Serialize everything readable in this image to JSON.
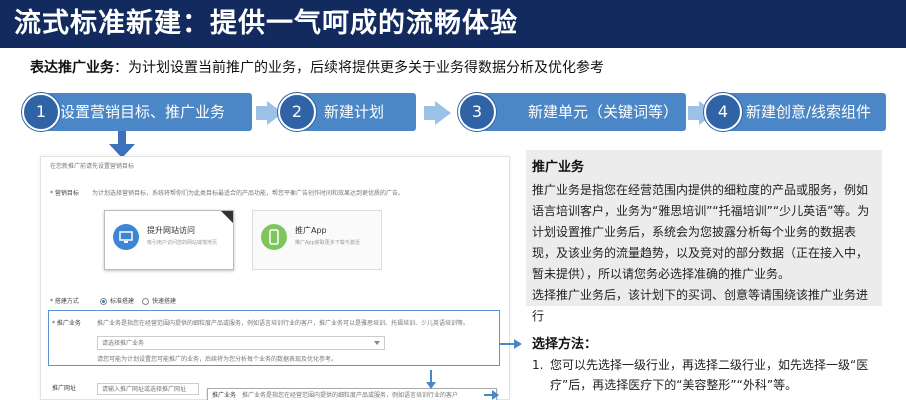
{
  "banner": {
    "title": "流式标准新建：提供一气呵成的流畅体验"
  },
  "intro": {
    "term": "表达推广业务",
    "text": "：为计划设置当前推广的业务，后续将提供更多关于业务得数据分析及优化参考"
  },
  "steps": [
    {
      "num": "1",
      "label": "设置营销目标、推广业务"
    },
    {
      "num": "2",
      "label": "新建计划"
    },
    {
      "num": "3",
      "label": "新建单元（关键词等）"
    },
    {
      "num": "4",
      "label": "新建创意/线索组件"
    }
  ],
  "form": {
    "header": "在您新推广前请先设置营销目标",
    "goal_label": "* 营销目标",
    "goal_hint": "为计划选择营销目标，系统将帮你们为此类目标最适合的产品功能，帮您平衡广告创作时间和效果达到更优质的广告。",
    "goals": [
      {
        "title": "提升网站访问",
        "sub": "吸引用户访问您的网站或落地页"
      },
      {
        "title": "推广App",
        "sub": "推广App获取更多下载与激活"
      }
    ],
    "mode_label": "* 搭建方式",
    "mode_options": [
      "标准搭建",
      "快速搭建"
    ],
    "business_label": "* 推广业务",
    "business_hint": "推广业务是指您在经营范围内提供的细粒度产品或服务，例如语言培训行业的客户，推广业务可以是雅思培训、托福培训、少儿英语培训等。",
    "business_placeholder": "请选择推广业务",
    "business_note": "请您可能为计划设置您可能推广的业务，后续将为您分析每个业务的数据表现及优化参考。",
    "url_label": "推广网址",
    "url_placeholder": "请输入推广网址或选择推广网址",
    "callout_label": "推广业务",
    "callout_text": "推广业务是指您在经营范围内提供的细粒度产品或服务，例如语言培训行业的客户"
  },
  "explain": {
    "title": "推广业务",
    "body": "推广业务是指您在经营范围内提供的细粒度的产品或服务，例如语言培训客户，业务为“雅思培训”“托福培训”“少儿英语”等。为计划设置推广业务后，系统会为您披露分析每个业务的数据表现，及该业务的流量趋势，以及竞对的部分数据（正在接入中，暂未提供），所以请您务必选择准确的推广业务。",
    "note": "选择推广业务后，该计划下的买词、创意等请围绕该推广业务进行"
  },
  "method": {
    "title": "选择方法：",
    "items": [
      {
        "num": "1.",
        "text": "您可以先选择一级行业，再选择二级行业，如先选择一级“医疗”后，再选择医疗下的“美容整形”“外科”等。"
      }
    ]
  }
}
